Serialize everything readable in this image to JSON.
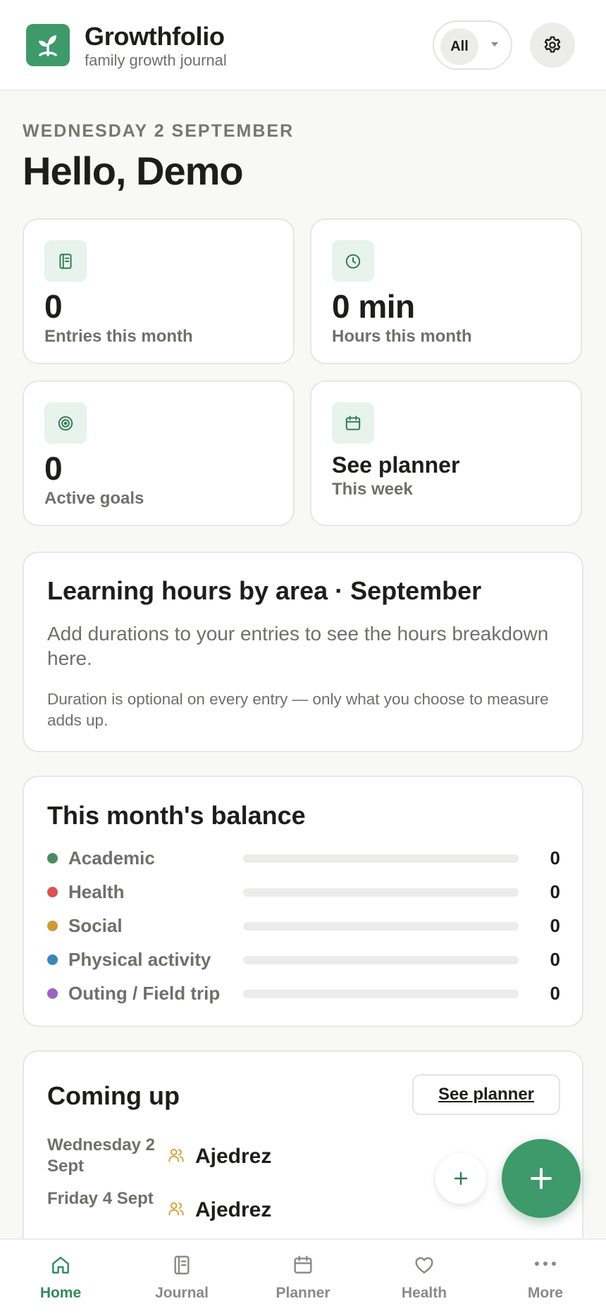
{
  "header": {
    "app_name": "Growthfolio",
    "tagline": "family growth journal",
    "filter_value": "All",
    "logo_icon": "sprout-icon",
    "settings_icon": "gear-icon"
  },
  "greeting": {
    "date": "WEDNESDAY 2 SEPTEMBER",
    "hello": "Hello, Demo"
  },
  "stats": {
    "entries": {
      "value": "0",
      "label": "Entries this month",
      "icon": "journal-icon"
    },
    "hours": {
      "value": "0 min",
      "label": "Hours this month",
      "icon": "clock-icon"
    },
    "goals": {
      "value": "0",
      "label": "Active goals",
      "icon": "target-icon"
    },
    "planner": {
      "title": "See planner",
      "subtitle": "This week",
      "icon": "calendar-icon"
    }
  },
  "hours_by_area": {
    "title": "Learning hours by area · September",
    "description": "Add durations to your entries to see the hours breakdown here.",
    "note": "Duration is optional on every entry — only what you choose to measure adds up."
  },
  "balance": {
    "title": "This month's balance",
    "areas": [
      {
        "label": "Academic",
        "count": "0",
        "fraction": 0,
        "color": "#4e8a64"
      },
      {
        "label": "Health",
        "count": "0",
        "fraction": 0,
        "color": "#d9534f"
      },
      {
        "label": "Social",
        "count": "0",
        "fraction": 0,
        "color": "#cf9a32"
      },
      {
        "label": "Physical activity",
        "count": "0",
        "fraction": 0,
        "color": "#3a87b8"
      },
      {
        "label": "Outing / Field trip",
        "count": "0",
        "fraction": 0,
        "color": "#9c64c2"
      }
    ]
  },
  "coming_up": {
    "title": "Coming up",
    "see_planner": "See planner",
    "events": [
      {
        "date": "Wednesday 2 Sept",
        "title": "Ajedrez",
        "icon": "people-icon"
      },
      {
        "date": "Friday 4 Sept",
        "title": "Ajedrez",
        "icon": "people-icon"
      }
    ]
  },
  "fab": {
    "small_icon": "plus-icon",
    "main_icon": "plus-icon"
  },
  "nav": {
    "home": "Home",
    "journal": "Journal",
    "planner": "Planner",
    "health": "Health",
    "more": "More"
  },
  "colors": {
    "accent": "#3e9a6a",
    "accent_light": "#e7f3ec",
    "active_tab": "#2f8a5c",
    "event_icon": "#d9a23b"
  }
}
